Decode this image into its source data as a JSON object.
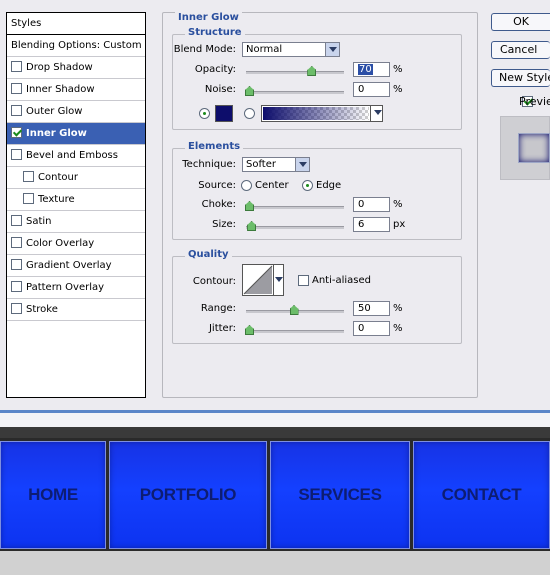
{
  "styles_list": {
    "header": "Styles",
    "items": [
      {
        "label": "Blending Options: Custom",
        "checkbox": false,
        "checked": false,
        "indent": false,
        "selected": false
      },
      {
        "label": "Drop Shadow",
        "checkbox": true,
        "checked": false,
        "indent": false,
        "selected": false
      },
      {
        "label": "Inner Shadow",
        "checkbox": true,
        "checked": false,
        "indent": false,
        "selected": false
      },
      {
        "label": "Outer Glow",
        "checkbox": true,
        "checked": false,
        "indent": false,
        "selected": false
      },
      {
        "label": "Inner Glow",
        "checkbox": true,
        "checked": true,
        "indent": false,
        "selected": true
      },
      {
        "label": "Bevel and Emboss",
        "checkbox": true,
        "checked": false,
        "indent": false,
        "selected": false
      },
      {
        "label": "Contour",
        "checkbox": true,
        "checked": false,
        "indent": true,
        "selected": false
      },
      {
        "label": "Texture",
        "checkbox": true,
        "checked": false,
        "indent": true,
        "selected": false
      },
      {
        "label": "Satin",
        "checkbox": true,
        "checked": false,
        "indent": false,
        "selected": false
      },
      {
        "label": "Color Overlay",
        "checkbox": true,
        "checked": false,
        "indent": false,
        "selected": false
      },
      {
        "label": "Gradient Overlay",
        "checkbox": true,
        "checked": false,
        "indent": false,
        "selected": false
      },
      {
        "label": "Pattern Overlay",
        "checkbox": true,
        "checked": false,
        "indent": false,
        "selected": false
      },
      {
        "label": "Stroke",
        "checkbox": true,
        "checked": false,
        "indent": false,
        "selected": false
      }
    ]
  },
  "panel": {
    "title": "Inner Glow",
    "structure": {
      "legend": "Structure",
      "blend_mode_label": "Blend Mode:",
      "blend_mode_value": "Normal",
      "opacity_label": "Opacity:",
      "opacity_value": "70",
      "opacity_level": 0.7,
      "opacity_unit": "%",
      "noise_label": "Noise:",
      "noise_value": "0",
      "noise_level": 0,
      "noise_unit": "%",
      "color_swatch": "#0d0d6b"
    },
    "elements": {
      "legend": "Elements",
      "technique_label": "Technique:",
      "technique_value": "Softer",
      "source_label": "Source:",
      "source_center": "Center",
      "source_edge": "Edge",
      "choke_label": "Choke:",
      "choke_value": "0",
      "choke_level": 0,
      "choke_unit": "%",
      "size_label": "Size:",
      "size_value": "6",
      "size_level": 0.024,
      "size_unit": "px"
    },
    "quality": {
      "legend": "Quality",
      "contour_label": "Contour:",
      "anti_aliased_label": "Anti-aliased",
      "range_label": "Range:",
      "range_value": "50",
      "range_level": 0.5,
      "range_unit": "%",
      "jitter_label": "Jitter:",
      "jitter_value": "0",
      "jitter_level": 0,
      "jitter_unit": "%"
    }
  },
  "buttons": {
    "ok": "OK",
    "cancel": "Cancel",
    "new_style": "New Style...",
    "preview": "Preview"
  },
  "nav": {
    "items": [
      "HOME",
      "PORTFOLIO",
      "SERVICES",
      "CONTACT"
    ]
  },
  "colors": {
    "selection": "#3a60b3",
    "legend_text": "#2a4f9e",
    "nav_blue": "#1440ff",
    "nav_text": "#0d1d73"
  }
}
